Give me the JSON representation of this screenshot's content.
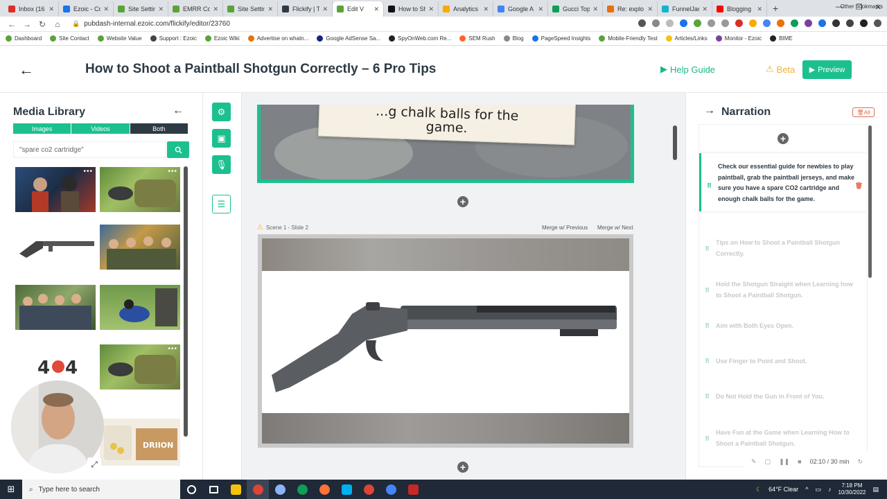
{
  "browser": {
    "tabs": [
      {
        "label": "Inbox (16",
        "color": "#d93025",
        "active": false
      },
      {
        "label": "Ezoic - Co",
        "color": "#1a73e8",
        "active": false
      },
      {
        "label": "Site Settin",
        "color": "#5aa33a",
        "active": false
      },
      {
        "label": "EMRR Co",
        "color": "#5aa33a",
        "active": false
      },
      {
        "label": "Site Settin",
        "color": "#5aa33a",
        "active": false
      },
      {
        "label": "Flickify | T",
        "color": "#2e3a44",
        "active": false
      },
      {
        "label": "Edit V",
        "color": "#5aa33a",
        "active": true
      },
      {
        "label": "How to Sh",
        "color": "#111111",
        "active": false
      },
      {
        "label": "Analytics",
        "color": "#f9ab00",
        "active": false
      },
      {
        "label": "Google A",
        "color": "#4285f4",
        "active": false
      },
      {
        "label": "Gucci Top",
        "color": "#0f9d58",
        "active": false
      },
      {
        "label": "Re: explo",
        "color": "#e8710a",
        "active": false
      },
      {
        "label": "FunnelJar",
        "color": "#12b5cb",
        "active": false
      },
      {
        "label": "Blogging",
        "color": "#ff0000",
        "active": false
      }
    ],
    "url": "pubdash-internal.ezoic.com/flickify/editor/23760",
    "bookmarks": [
      {
        "label": "Dashboard",
        "color": "#5aa33a"
      },
      {
        "label": "Site Contact",
        "color": "#5aa33a"
      },
      {
        "label": "Website Value",
        "color": "#5aa33a"
      },
      {
        "label": "Support : Ezoic",
        "color": "#444444"
      },
      {
        "label": "Ezoic Wiki",
        "color": "#5aa33a"
      },
      {
        "label": "Advertise on whatn...",
        "color": "#e8710a"
      },
      {
        "label": "Google AdSense Sa...",
        "color": "#1a237e"
      },
      {
        "label": "SpyOnWeb.com Re...",
        "color": "#222222"
      },
      {
        "label": "SEM Rush",
        "color": "#ff642d"
      },
      {
        "label": "Blog",
        "color": "#888888"
      },
      {
        "label": "PageSpeed Insights",
        "color": "#1a73e8"
      },
      {
        "label": "Mobile-Friendly Test",
        "color": "#5aa33a"
      },
      {
        "label": "Articles/Links",
        "color": "#f4c20d"
      },
      {
        "label": "Monitor - Ezoic",
        "color": "#7b3fa0"
      },
      {
        "label": "BIME",
        "color": "#222222"
      }
    ],
    "other_bookmarks": "Other bookmarks"
  },
  "header": {
    "title": "How to Shoot a Paintball Shotgun Correctly – 6 Pro Tips",
    "help_label": "Help Guide",
    "beta_label": "Beta",
    "preview_label": "Preview"
  },
  "media_library": {
    "title": "Media Library",
    "tabs": [
      "Images",
      "Videos",
      "Both"
    ],
    "selected_tab": "Both",
    "search_value": "\"spare co2 cartridge\""
  },
  "canvas": {
    "slide1_caption_line1": "...g chalk balls for the",
    "slide1_caption_line2": "game.",
    "scene_label": "Scene 1 - Slide 2",
    "merge_prev": "Merge w/ Previous",
    "merge_next": "Merge w/ Next"
  },
  "narration": {
    "title": "Narration",
    "delete_all": "All",
    "items": [
      "Check our essential guide for newbies to play paintball, grab the paintball jerseys, and make sure you have a spare CO2 cartridge and enough chalk balls for the game.",
      "Tips on How to Shoot a Paintball Shotgun Correctly.",
      "Hold the Shotgun Straight when Learning how to Shoot a Paintball Shotgun.",
      "Aim with Both Eyes Open.",
      "Use Finger to Point and Shoot.",
      "Do Not Hold the Gun in Front of You.",
      "Have Fun at the Game when Learning How to Shoot a Paintball Shotgun."
    ],
    "timer": "02:10 / 30 min"
  },
  "taskbar": {
    "search_placeholder": "Type here to search",
    "weather": "64°F  Clear",
    "time": "7:18 PM",
    "date": "10/30/2022"
  },
  "colors": {
    "accent": "#1cc08f",
    "dark": "#2e3a44",
    "warning": "#f1b22f",
    "danger": "#e06c4c"
  }
}
